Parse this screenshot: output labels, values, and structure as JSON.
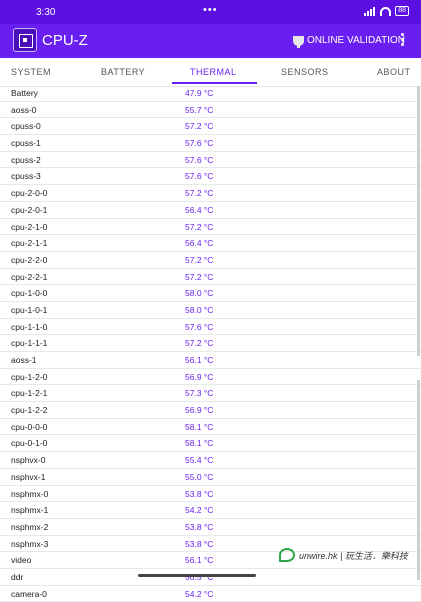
{
  "status_bar": {
    "time": "3:30",
    "dots": "•••",
    "battery": "88"
  },
  "app_bar": {
    "title": "CPU-Z",
    "validation_label": "ONLINE VALIDATION"
  },
  "tabs": [
    {
      "label": "SYSTEM"
    },
    {
      "label": "BATTERY"
    },
    {
      "label": "THERMAL"
    },
    {
      "label": "SENSORS"
    },
    {
      "label": "ABOUT"
    }
  ],
  "active_tab": "THERMAL",
  "thermal": [
    {
      "name": "Battery",
      "value": "47.9 °C"
    },
    {
      "name": "aoss-0",
      "value": "55.7 °C"
    },
    {
      "name": "cpuss-0",
      "value": "57.2 °C"
    },
    {
      "name": "cpuss-1",
      "value": "57.6 °C"
    },
    {
      "name": "cpuss-2",
      "value": "57.6 °C"
    },
    {
      "name": "cpuss-3",
      "value": "57.6 °C"
    },
    {
      "name": "cpu-2-0-0",
      "value": "57.2 °C"
    },
    {
      "name": "cpu-2-0-1",
      "value": "56.4 °C"
    },
    {
      "name": "cpu-2-1-0",
      "value": "57.2 °C"
    },
    {
      "name": "cpu-2-1-1",
      "value": "56.4 °C"
    },
    {
      "name": "cpu-2-2-0",
      "value": "57.2 °C"
    },
    {
      "name": "cpu-2-2-1",
      "value": "57.2 °C"
    },
    {
      "name": "cpu-1-0-0",
      "value": "58.0 °C"
    },
    {
      "name": "cpu-1-0-1",
      "value": "58.0 °C"
    },
    {
      "name": "cpu-1-1-0",
      "value": "57.6 °C"
    },
    {
      "name": "cpu-1-1-1",
      "value": "57.2 °C"
    },
    {
      "name": "aoss-1",
      "value": "56.1 °C"
    },
    {
      "name": "cpu-1-2-0",
      "value": "56.9 °C"
    },
    {
      "name": "cpu-1-2-1",
      "value": "57.3 °C"
    },
    {
      "name": "cpu-1-2-2",
      "value": "56.9 °C"
    },
    {
      "name": "cpu-0-0-0",
      "value": "58.1 °C"
    },
    {
      "name": "cpu-0-1-0",
      "value": "58.1 °C"
    },
    {
      "name": "nsphvx-0",
      "value": "55.4 °C"
    },
    {
      "name": "nsphvx-1",
      "value": "55.0 °C"
    },
    {
      "name": "nsphmx-0",
      "value": "53.8 °C"
    },
    {
      "name": "nsphmx-1",
      "value": "54.2 °C"
    },
    {
      "name": "nsphmx-2",
      "value": "53.8 °C"
    },
    {
      "name": "nsphmx-3",
      "value": "53.8 °C"
    },
    {
      "name": "video",
      "value": "56.1 °C"
    },
    {
      "name": "ddr",
      "value": "56.5 °C"
    },
    {
      "name": "camera-0",
      "value": "54.2 °C"
    }
  ],
  "watermark": {
    "text": "unwire.hk | 玩生活．樂科技"
  },
  "colors": {
    "status_bar": "#5b0fe0",
    "app_bar": "#6a1ff2",
    "accent": "#6a1ff2"
  }
}
